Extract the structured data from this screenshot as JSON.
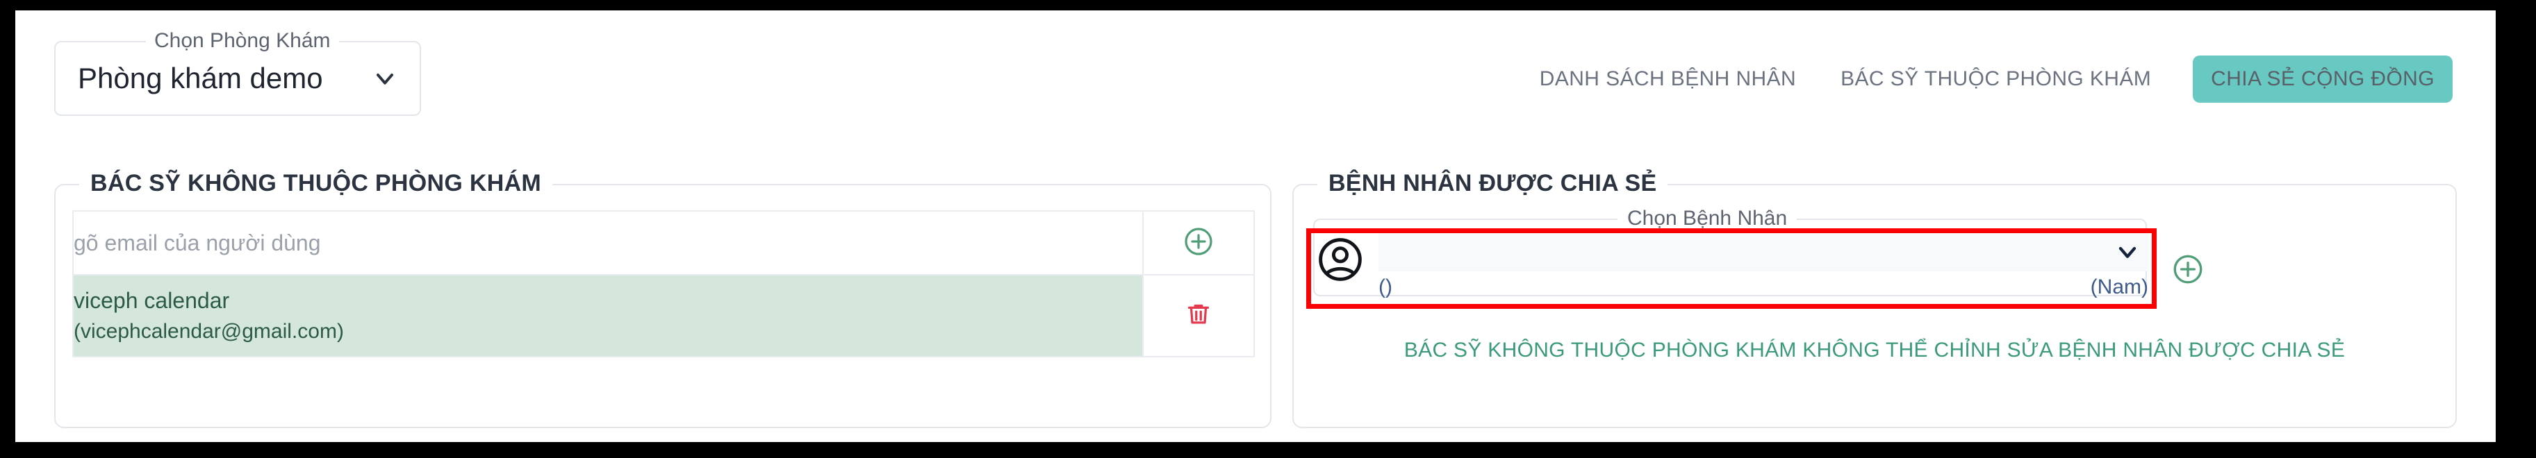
{
  "topbar": {
    "clinic_select": {
      "legend": "Chọn Phòng Khám",
      "value": "Phòng khám demo",
      "chevron_icon": "chevron-down-icon"
    },
    "nav": [
      {
        "label": "DANH SÁCH BỆNH NHÂN"
      },
      {
        "label": "BÁC SỸ THUỘC PHÒNG KHÁM"
      }
    ],
    "share_button": {
      "label": "CHIA SẺ CỘNG ĐỒNG"
    }
  },
  "left_panel": {
    "legend": "BÁC SỸ KHÔNG THUỘC PHÒNG KHÁM",
    "email_input": {
      "placeholder": "gõ email của người dùng",
      "value": ""
    },
    "add_icon": "plus-circle-icon",
    "delete_icon": "trash-icon",
    "doctors": [
      {
        "name": "viceph calendar",
        "email": "(vicephcalendar@gmail.com)"
      }
    ]
  },
  "right_panel": {
    "legend": "BỆNH NHÂN ĐƯỢC CHIA SẺ",
    "patient_select": {
      "legend": "Chọn Bệnh Nhân",
      "value": "",
      "code": "()",
      "gender": "(Nam)",
      "avatar_icon": "account-circle-icon",
      "chevron_icon": "chevron-down-icon"
    },
    "add_icon": "plus-circle-icon",
    "note": "BÁC SỸ KHÔNG THUỘC PHÒNG KHÁM KHÔNG THỂ CHỈNH SỬA BỆNH NHÂN ĐƯỢC CHIA SẺ"
  },
  "colors": {
    "accent_teal": "#67c9c2",
    "row_green": "#d5e6dc",
    "note_green": "#3c9a7c",
    "add_green": "#4f9e78",
    "delete_red": "#e53950",
    "highlight_red": "#fb0000"
  }
}
